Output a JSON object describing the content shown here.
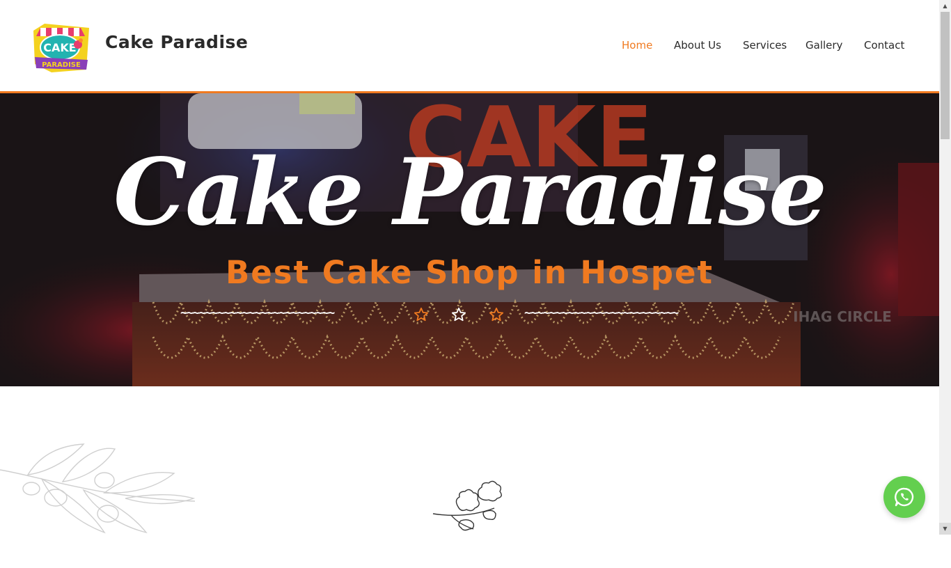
{
  "header": {
    "logo_text_top": "CAKE",
    "logo_text_bottom": "PARADISE",
    "brand_name": "Cake Paradise"
  },
  "nav": {
    "items": [
      {
        "label": "Home",
        "active": true
      },
      {
        "label": "About Us",
        "active": false
      },
      {
        "label": "Services",
        "active": false
      },
      {
        "label": "Gallery",
        "active": false
      },
      {
        "label": "Contact",
        "active": false
      }
    ]
  },
  "hero": {
    "title": "Cake Paradise",
    "subtitle": "Best Cake Shop in Hospet",
    "divider_left": "~~~~~~~~~~~~~~~~~~~~~~~~~",
    "divider_right": "~~~~~~~~~~~~~~~~~~~~~~~~~",
    "background_sign_text": "CAKE",
    "background_street_text": "IHAG CIRCLE"
  },
  "colors": {
    "accent": "#f07a20",
    "text_dark": "#2a2a2a",
    "whatsapp": "#63cf4f",
    "hero_title": "#ffffff"
  },
  "icons": {
    "divider_stars": [
      "star-outline-icon",
      "star-outline-icon",
      "star-outline-icon"
    ],
    "floating_button": "whatsapp-icon",
    "section_ornament": "leaf-sprig-icon",
    "background_decoration": "olive-branch-sketch"
  }
}
